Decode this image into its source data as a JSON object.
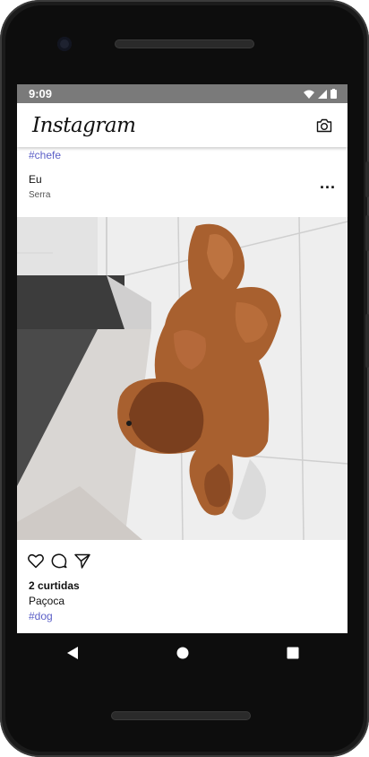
{
  "status_bar": {
    "time": "9:09"
  },
  "app": {
    "logo_text": "Instagram"
  },
  "feed": {
    "previous_post_hashtag": "#chefe"
  },
  "post": {
    "author": "Eu",
    "location": "Serra",
    "more_label": "...",
    "likes_label": "2 curtidas",
    "caption": "Paçoca",
    "hashtag": "#dog"
  },
  "icons": {
    "camera": "camera-icon",
    "like": "heart-icon",
    "comment": "comment-icon",
    "share": "send-icon",
    "back": "back-icon",
    "home": "home-icon",
    "recents": "recents-icon"
  },
  "colors": {
    "hashtag": "#5b5fc7",
    "status_bar": "#7a7a7a"
  }
}
